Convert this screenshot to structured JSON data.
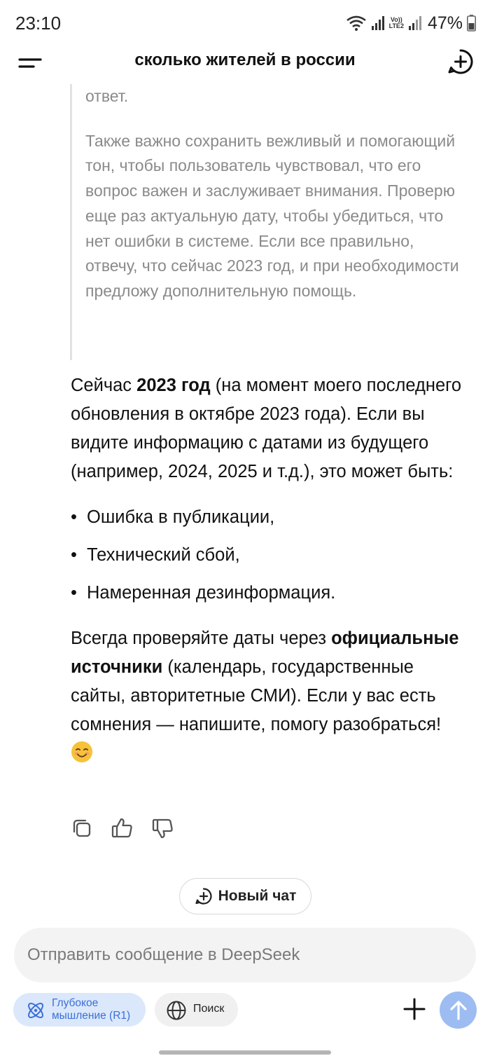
{
  "status_bar": {
    "time": "23:10",
    "lte_line1": "Vo))",
    "lte_line2": "LTE2",
    "battery_percent": "47%",
    "icons": [
      "wifi-icon",
      "signal-icon",
      "signal-icon-2",
      "battery-icon"
    ]
  },
  "header": {
    "title": "сколько жителей в россии",
    "menu_icon": "menu-icon",
    "new_chat_icon": "new-chat-plus-circle-icon"
  },
  "thinking": {
    "paragraphs": [
      "ответ.",
      "Также важно сохранить вежливый и помогающий тон, чтобы пользователь чувствовал, что его вопрос важен и заслуживает внимания. Проверю еще раз актуальную дату, чтобы убедиться, что нет ошибки в системе. Если все правильно, отвечу, что сейчас 2023 год, и при необходимости предложу дополнительную помощь."
    ]
  },
  "answer": {
    "p1_before": "Сейчас ",
    "p1_bold": "2023 год",
    "p1_after": " (на момент моего последнего обновления в октябре 2023 года). Если вы видите информацию с датами из будущего (например, 2024, 2025 и т.д.), это может быть:",
    "bullet_char": "•",
    "bullets": [
      "Ошибка в публикации,",
      "Технический сбой,",
      "Намеренная дезинформация."
    ],
    "p2_before": "Всегда проверяйте даты через ",
    "p2_bold": "официальные источники",
    "p2_after": " (календарь, государственные сайты, авторитетные СМИ). Если у вас есть сомнения — напишите, помогу разобраться! ",
    "emoji_icon": "smiling-face-emoji-icon"
  },
  "actions": {
    "icons": [
      "copy-icon",
      "thumbs-up-icon",
      "thumbs-down-icon"
    ]
  },
  "new_chat": {
    "label": "Новый чат"
  },
  "composer": {
    "placeholder": "Отправить сообщение в DeepSeek",
    "value": ""
  },
  "controls": {
    "deepthink_line1": "Глубокое",
    "deepthink_line2": "мышление (R1)",
    "search_label": "Поиск",
    "accent_color": "#3b6fd8",
    "deepthink_bg": "#dbe8fb",
    "send_color": "#9dbdf2"
  }
}
